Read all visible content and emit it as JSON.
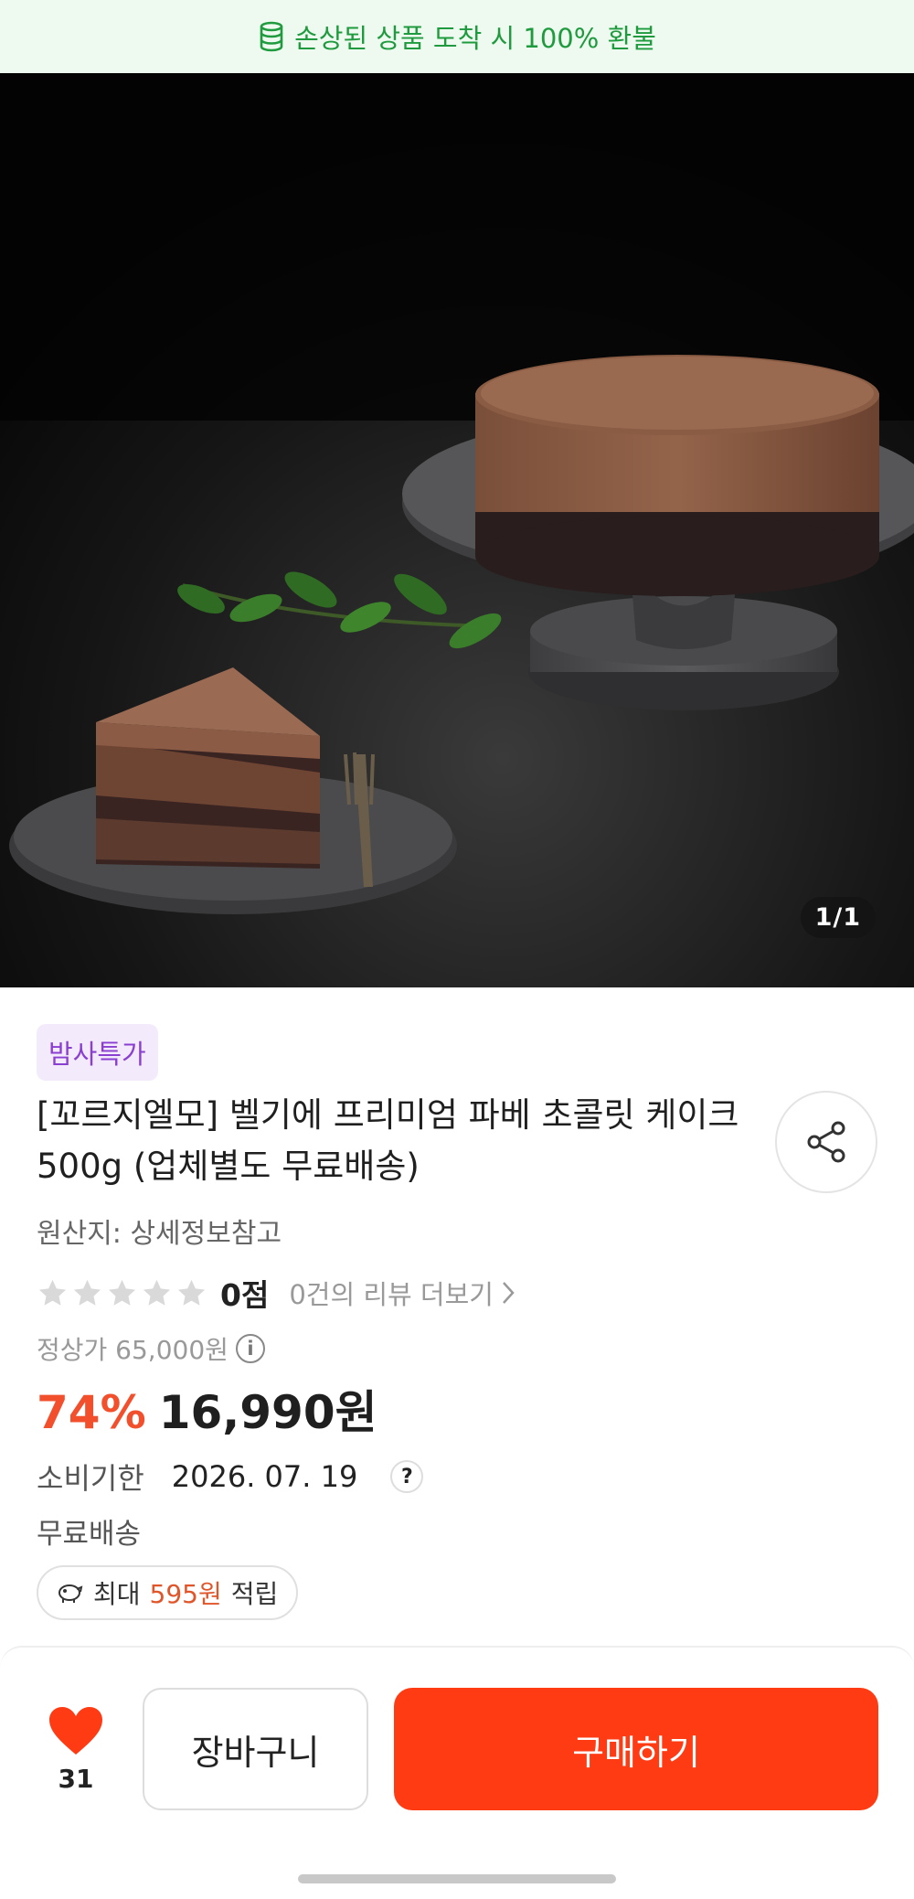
{
  "banner": {
    "icon": "coins-icon",
    "text": "손상된 상품 도착 시 100% 환불",
    "color": "#1f9a3e"
  },
  "gallery": {
    "counter": "1/1",
    "image": "chocolate-cake-photo"
  },
  "product": {
    "badge": "밤사특가",
    "title": "[꼬르지엘모] 벨기에 프리미엄 파베 초콜릿 케이크 500g (업체별도 무료배송)",
    "origin": "원산지: 상세정보참고",
    "rating": {
      "stars": 0,
      "score": "0점",
      "review_link": "0건의 리뷰 더보기"
    },
    "original_price": "정상가 65,000원",
    "discount": "74%",
    "price": "16,990원",
    "expiry": {
      "label": "소비기한",
      "value": "2026. 07. 19"
    },
    "shipping": "무료배송",
    "points": {
      "prefix": "최대",
      "amount": "595원",
      "suffix": "적립"
    }
  },
  "actions": {
    "like_count": "31",
    "cart_label": "장바구니",
    "buy_label": "구매하기",
    "accent": "#ff3b14"
  }
}
